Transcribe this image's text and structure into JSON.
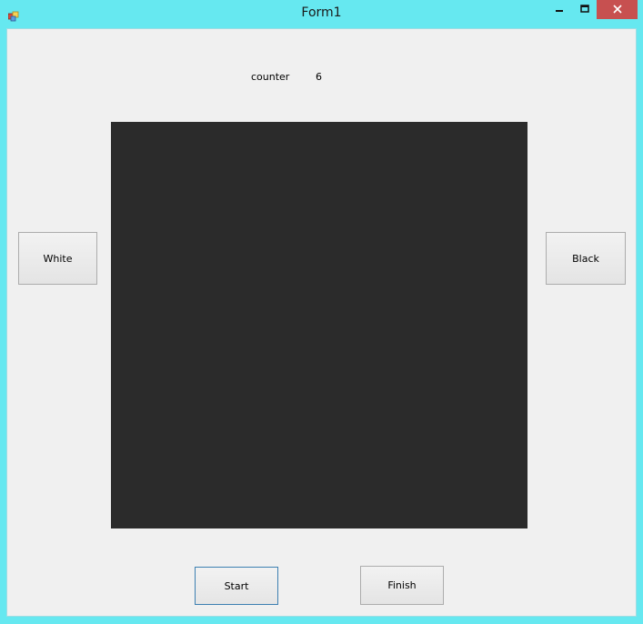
{
  "window": {
    "title": "Form1",
    "close_symbol": "✕",
    "minimize_symbol": "—",
    "maximize_symbol": "☐"
  },
  "counter": {
    "label": "counter",
    "value": "6"
  },
  "buttons": {
    "white": "White",
    "black": "Black",
    "start": "Start",
    "finish": "Finish"
  },
  "colors": {
    "titlebar": "#66e8f0",
    "canvas": "#2b2b2b",
    "close_button": "#c75050",
    "focus_border": "#3c7fb1"
  },
  "icons": {
    "app": "windows-form-icon",
    "minimize": "minimize-icon",
    "maximize": "maximize-icon",
    "close": "close-icon"
  }
}
